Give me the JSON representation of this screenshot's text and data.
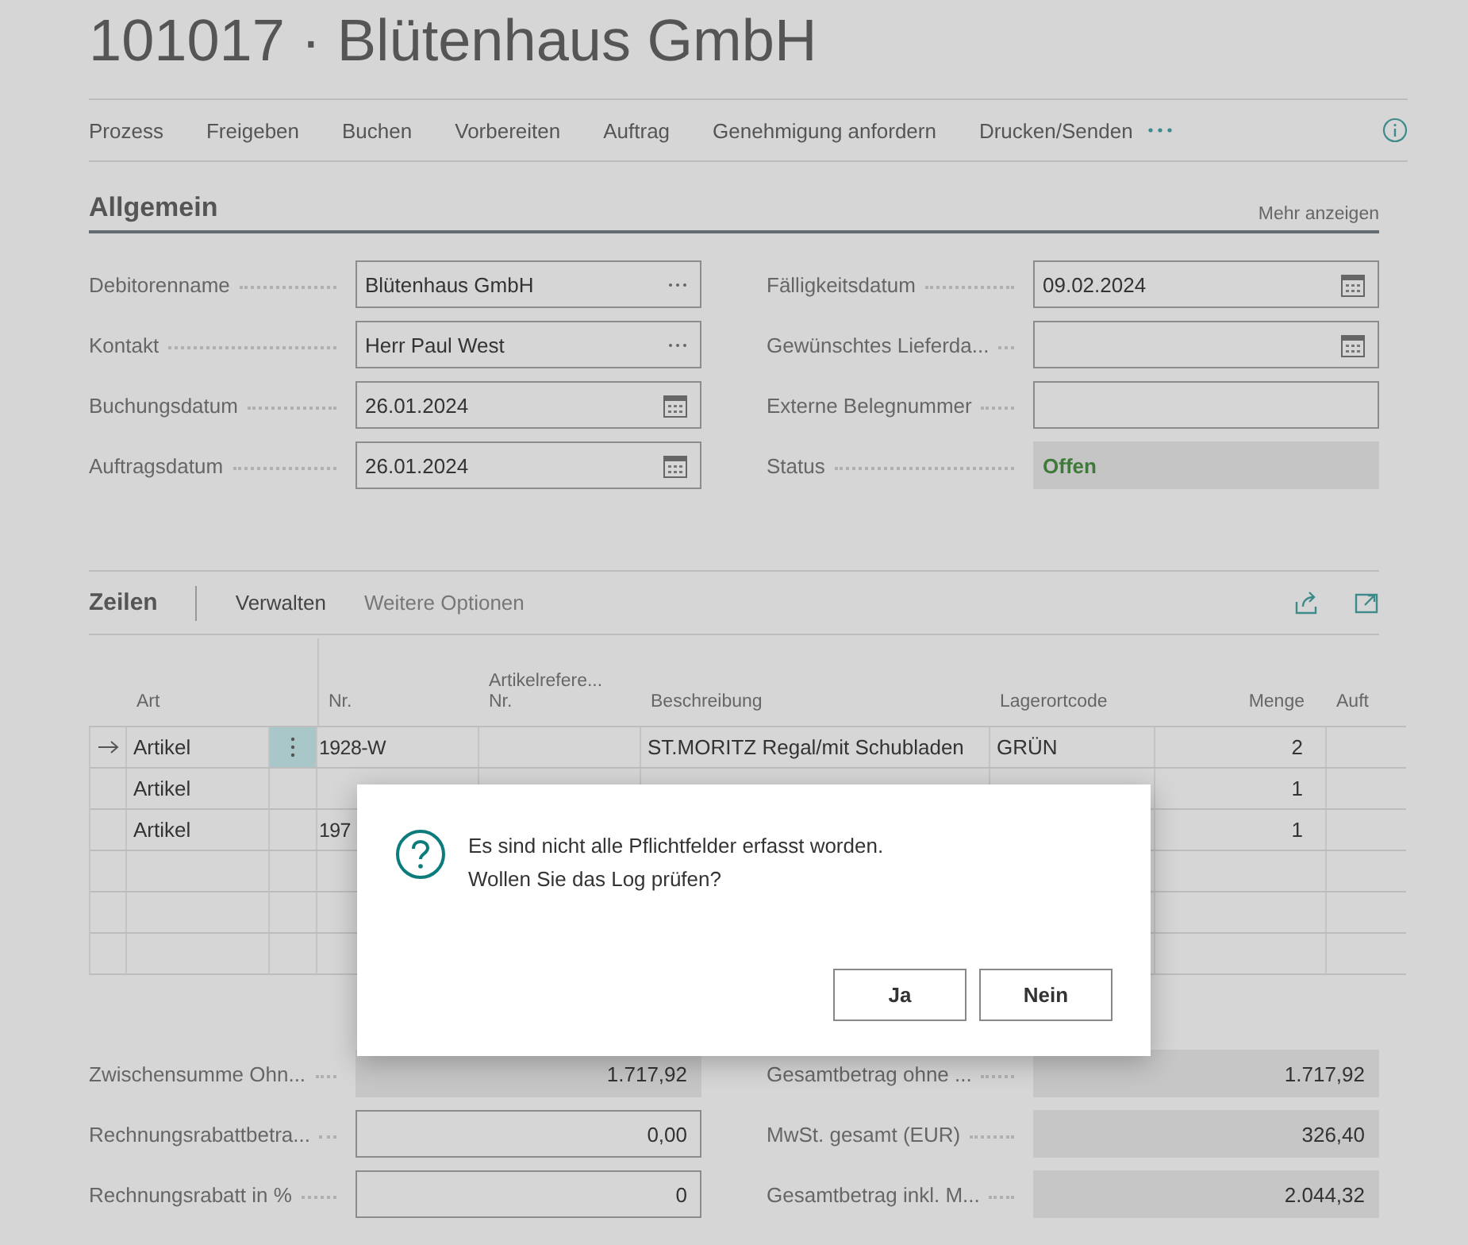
{
  "title": "101017 · Blütenhaus GmbH",
  "actions": [
    "Prozess",
    "Freigeben",
    "Buchen",
    "Vorbereiten",
    "Auftrag",
    "Genehmigung anfordern",
    "Drucken/Senden"
  ],
  "general": {
    "title": "Allgemein",
    "more": "Mehr anzeigen",
    "left": [
      {
        "label": "Debitorenname",
        "value": "Blütenhaus GmbH",
        "kind": "lookup"
      },
      {
        "label": "Kontakt",
        "value": "Herr Paul West",
        "kind": "lookup"
      },
      {
        "label": "Buchungsdatum",
        "value": "26.01.2024",
        "kind": "date"
      },
      {
        "label": "Auftragsdatum",
        "value": "26.01.2024",
        "kind": "date"
      }
    ],
    "right": [
      {
        "label": "Fälligkeitsdatum",
        "value": "09.02.2024",
        "kind": "date"
      },
      {
        "label": "Gewünschtes Lieferda...",
        "kind": "date"
      },
      {
        "label": "Externe Belegnummer",
        "kind": "text"
      },
      {
        "label": "Status",
        "value": "Offen",
        "kind": "status"
      }
    ]
  },
  "lines": {
    "title": "Zeilen",
    "actions": [
      "Verwalten",
      "Weitere Optionen"
    ],
    "columns": [
      "Art",
      "Nr.",
      "Artikelrefere...\nNr.",
      "Beschreibung",
      "Lagerortcode",
      "Menge",
      "Auft"
    ],
    "rows": [
      {
        "selected": true,
        "art": "Artikel",
        "nr": "1928-W",
        "desc": "ST.MORITZ Regal/mit Schubladen",
        "loc": "GRÜN",
        "qty": "2"
      },
      {
        "selected": false,
        "art": "Artikel",
        "qty": "1"
      },
      {
        "selected": false,
        "art": "Artikel",
        "nr": "197",
        "qty": "1"
      },
      {
        "selected": false
      },
      {
        "selected": false
      },
      {
        "selected": false
      }
    ]
  },
  "totals": {
    "left": [
      {
        "label": "Zwischensumme Ohn...",
        "value": "1.717,92",
        "kind": "readonly"
      },
      {
        "label": "Rechnungsrabattbetra...",
        "value": "0,00",
        "kind": "input"
      },
      {
        "label": "Rechnungsrabatt in %",
        "value": "0",
        "kind": "input"
      }
    ],
    "right": [
      {
        "label": "Gesamtbetrag ohne ...",
        "value": "1.717,92",
        "kind": "readonly"
      },
      {
        "label": "MwSt. gesamt (EUR)",
        "value": "326,40",
        "kind": "readonly"
      },
      {
        "label": "Gesamtbetrag inkl. M...",
        "value": "2.044,32",
        "kind": "readonly"
      }
    ]
  },
  "dialog": {
    "message": "Es sind nicht alle Pflichtfelder erfasst worden.\nWollen Sie das Log prüfen?",
    "buttons": [
      "Ja",
      "Nein"
    ]
  }
}
